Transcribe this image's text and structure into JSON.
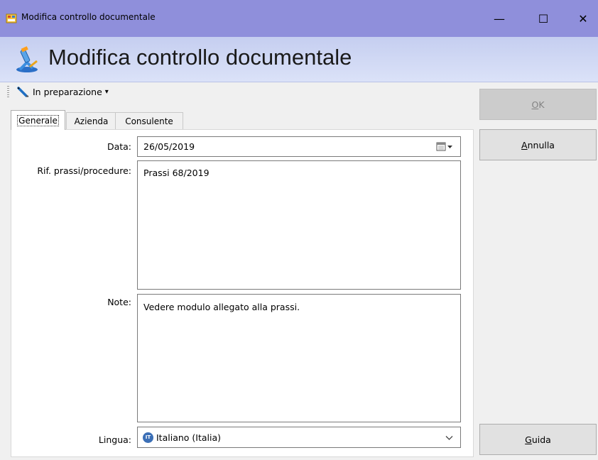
{
  "window": {
    "title": "Modifica controllo documentale",
    "minimize_glyph": "—",
    "maximize_glyph": "☐",
    "close_glyph": "✕"
  },
  "header": {
    "title": "Modifica controllo documentale"
  },
  "toolbar": {
    "status_label": "In preparazione",
    "status_arrow": "▾"
  },
  "tabs": [
    {
      "label": "Generale",
      "active": true
    },
    {
      "label": "Azienda",
      "active": false
    },
    {
      "label": "Consulente",
      "active": false
    }
  ],
  "form": {
    "data_label": "Data:",
    "data_value": "26/05/2019",
    "rif_label": "Rif. prassi/procedure:",
    "rif_value": "Prassi 68/2019",
    "note_label": "Note:",
    "note_value": "Vedere modulo allegato alla prassi.",
    "lingua_label": "Lingua:",
    "lingua_flag": "IT",
    "lingua_value": "Italiano (Italia)"
  },
  "buttons": {
    "ok_accel": "O",
    "ok_rest": "K",
    "annulla_accel": "A",
    "annulla_rest": "nnulla",
    "guida_accel": "G",
    "guida_rest": "uida"
  },
  "colors": {
    "titlebar": "#8f8fdb",
    "header_gradient_top": "#c5cef0",
    "lingua_badge": "#3b6fb6",
    "pencil_blue": "#1f6fc4"
  },
  "icons": {
    "app": "form-app-icon",
    "header": "microscope-icon",
    "status": "pencil-icon",
    "calendar": "calendar-dropdown-icon",
    "combo": "chevron-down-icon"
  }
}
